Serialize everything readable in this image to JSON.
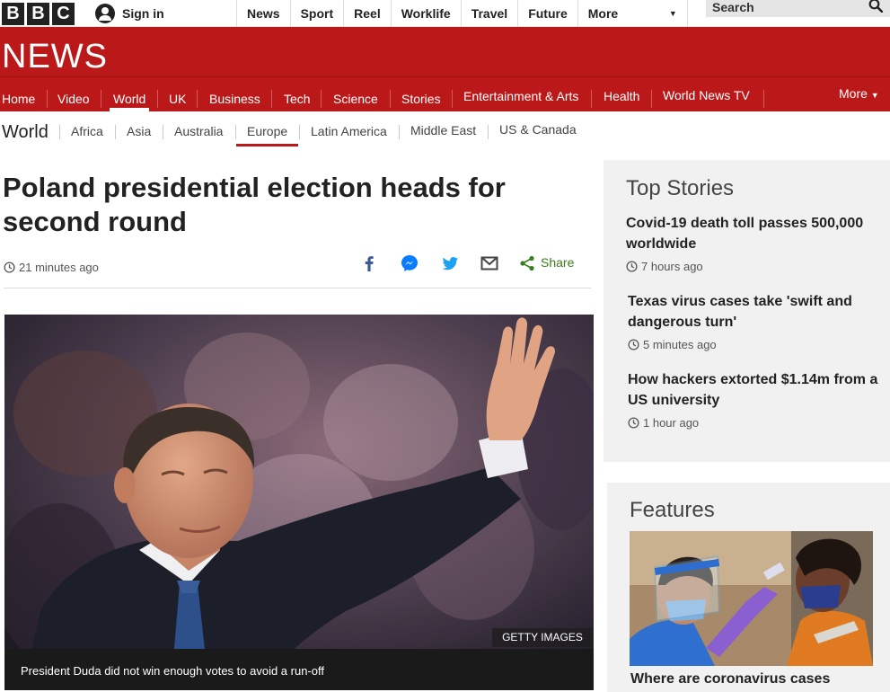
{
  "topbar": {
    "logo_letters": [
      "B",
      "B",
      "C"
    ],
    "signin_label": "Sign in",
    "nav_items": [
      {
        "label": "News"
      },
      {
        "label": "Sport"
      },
      {
        "label": "Reel"
      },
      {
        "label": "Worklife"
      },
      {
        "label": "Travel"
      },
      {
        "label": "Future"
      }
    ],
    "more_label": "More",
    "search_placeholder": "Search"
  },
  "news_band": {
    "wordmark": "NEWS",
    "color": "#bb1919"
  },
  "main_nav": {
    "items": [
      {
        "label": "Home"
      },
      {
        "label": "Video"
      },
      {
        "label": "World",
        "active": true
      },
      {
        "label": "UK"
      },
      {
        "label": "Business"
      },
      {
        "label": "Tech"
      },
      {
        "label": "Science"
      },
      {
        "label": "Stories"
      },
      {
        "label": "Entertainment & Arts"
      },
      {
        "label": "Health"
      },
      {
        "label": "World News TV"
      }
    ],
    "more_label": "More"
  },
  "sub_nav": {
    "section": "World",
    "items": [
      {
        "label": "Africa"
      },
      {
        "label": "Asia"
      },
      {
        "label": "Australia"
      },
      {
        "label": "Europe",
        "active": true
      },
      {
        "label": "Latin America"
      },
      {
        "label": "Middle East"
      },
      {
        "label": "US & Canada"
      }
    ]
  },
  "article": {
    "headline_line1": "Poland presidential election heads for",
    "headline_line2": "second round",
    "timestamp": "21 minutes ago",
    "share_icons": [
      "facebook-icon",
      "messenger-icon",
      "twitter-icon",
      "email-icon"
    ],
    "share_label": "Share",
    "image_credit": "GETTY IMAGES",
    "image_caption": "President Duda did not win enough votes to avoid a run-off"
  },
  "top_stories": {
    "title": "Top Stories",
    "items": [
      {
        "title": "Covid-19 death toll passes 500,000 worldwide",
        "time": "7 hours ago"
      },
      {
        "title": "Texas virus cases take 'swift and dangerous turn'",
        "time": "5 minutes ago"
      },
      {
        "title": "How hackers extorted $1.14m from a US university",
        "time": "1 hour ago"
      }
    ]
  },
  "features": {
    "title": "Features",
    "caption": "Where are coronavirus cases"
  }
}
